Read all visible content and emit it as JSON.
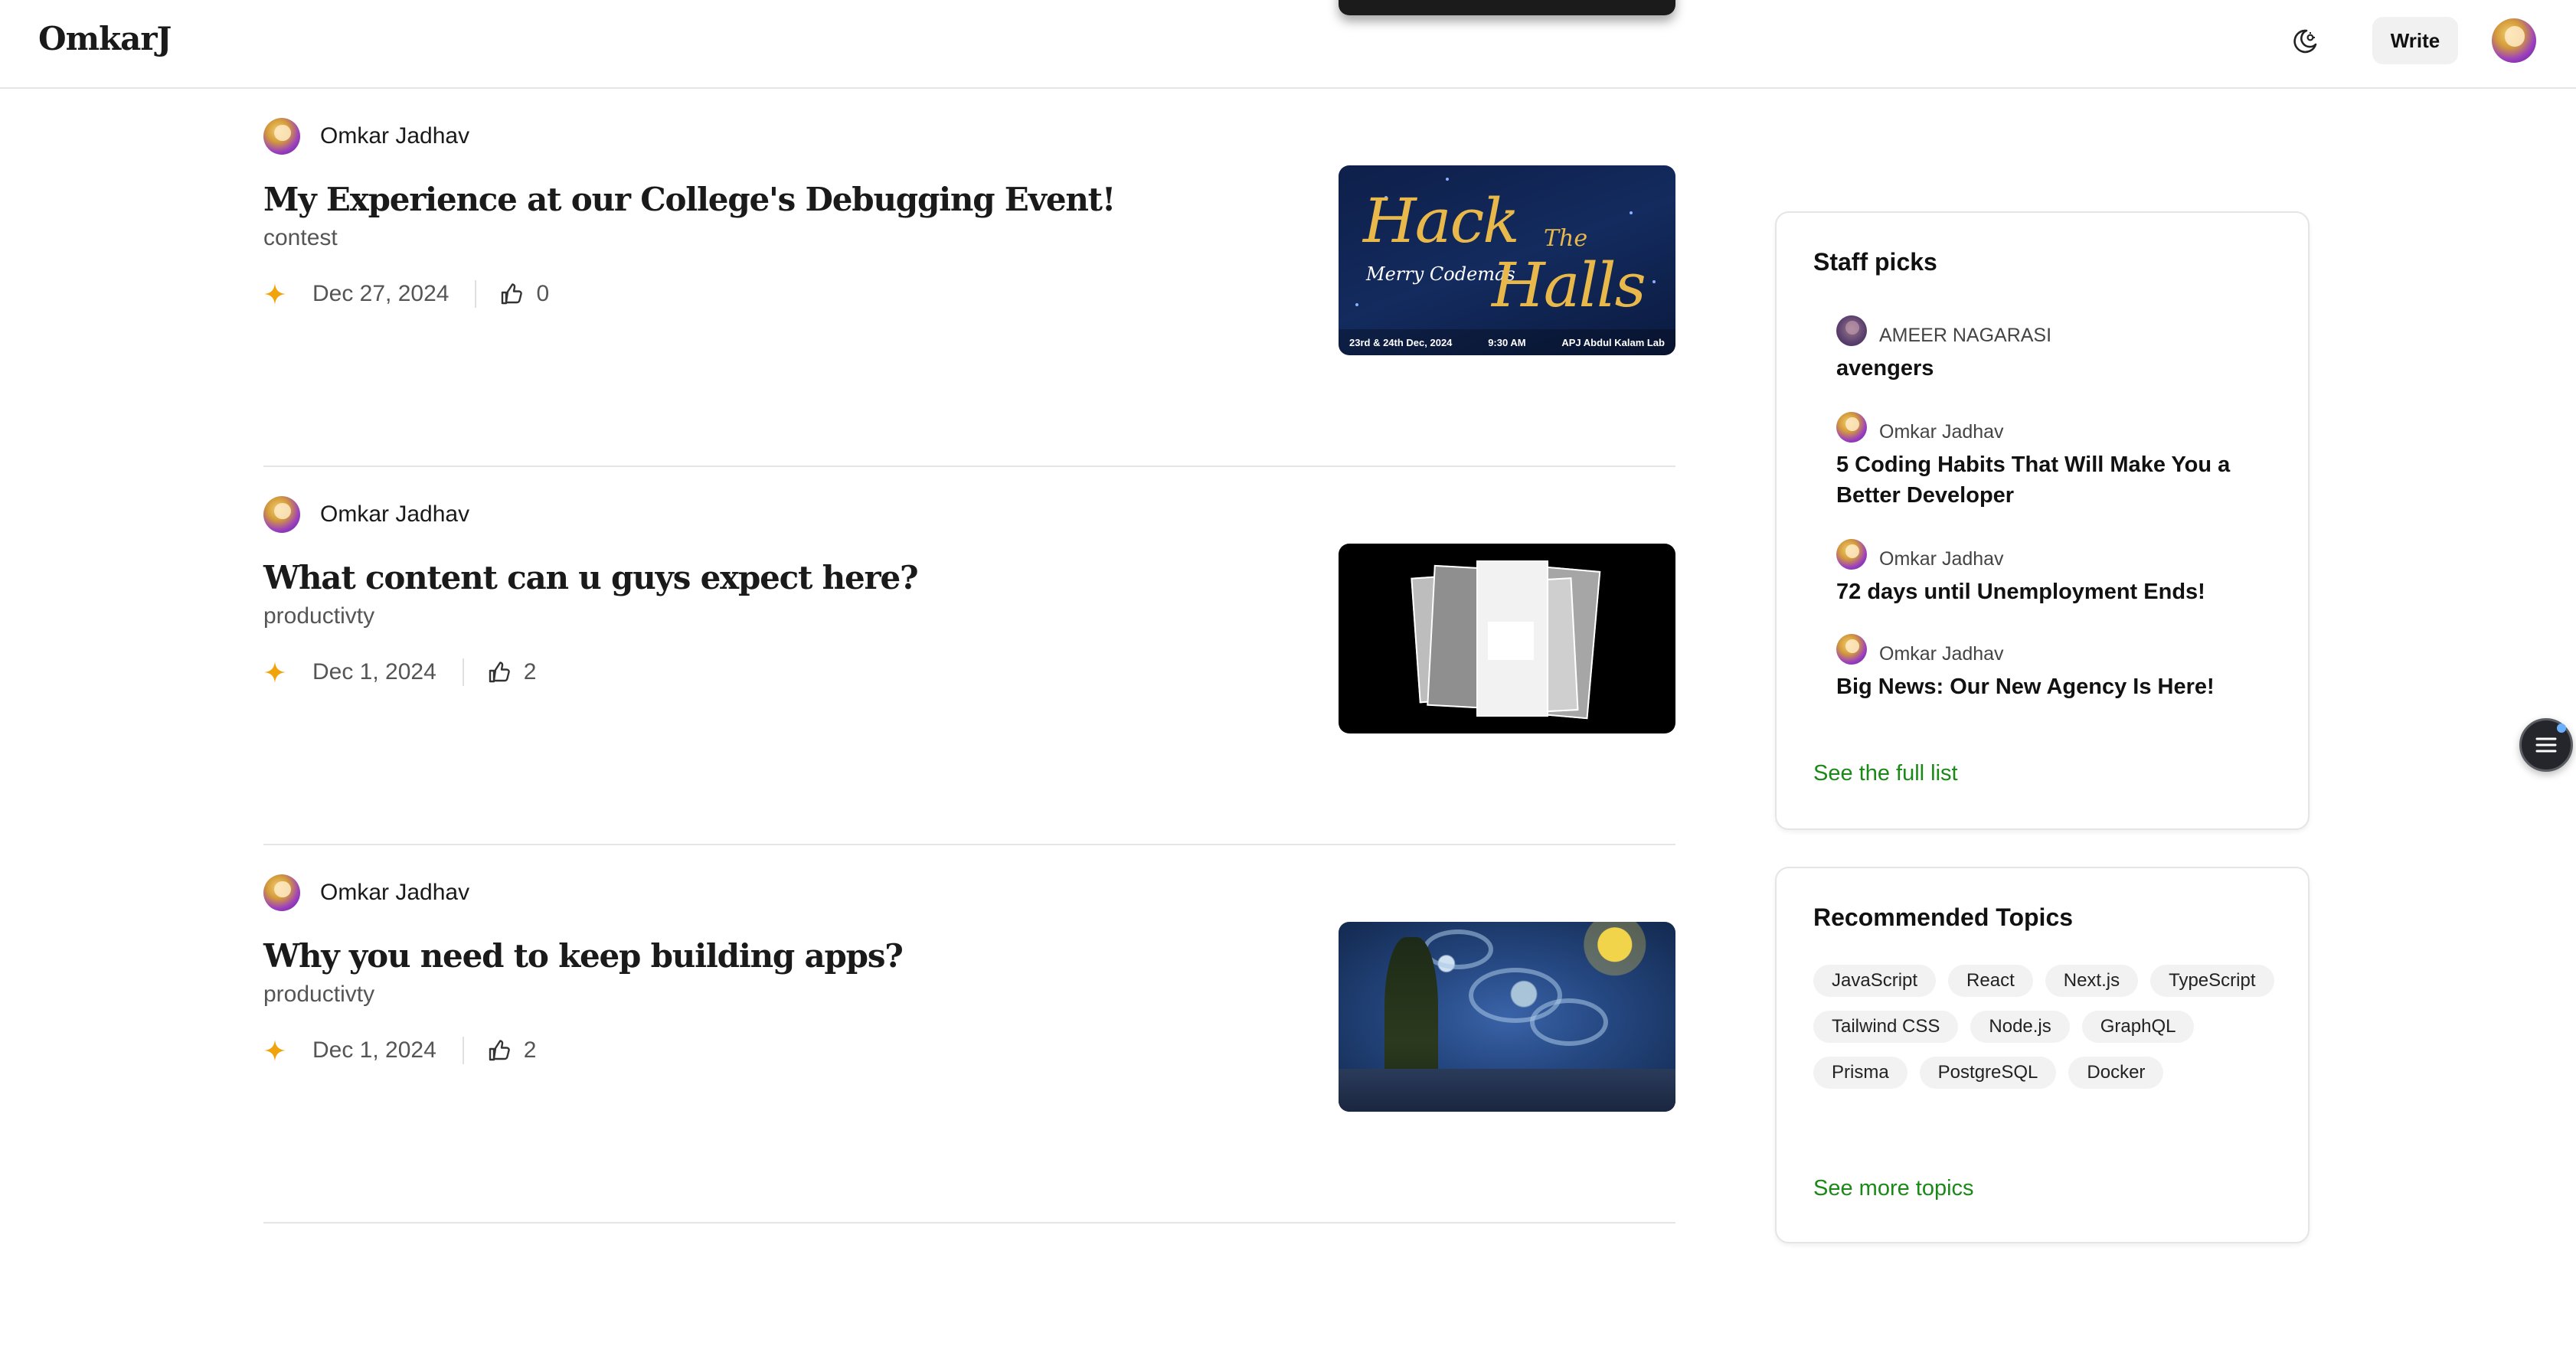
{
  "header": {
    "logo": "OmkarJ",
    "write_label": "Write"
  },
  "icons": {
    "theme_toggle": "moon-sun-icon",
    "like": "thumbs-up-icon",
    "member_star": "sparkle-star-icon",
    "fab": "menu-list-icon"
  },
  "colors": {
    "accent_green": "#1a8917",
    "star": "#f0a30a",
    "divider": "#e5e5e5"
  },
  "posts": [
    {
      "author": "Omkar Jadhav",
      "title": "My Experience at our College's Debugging Event!",
      "tag": "contest",
      "date": "Dec 27, 2024",
      "likes": "0",
      "image": {
        "hack": "Hack",
        "the": "The",
        "halls": "Halls",
        "merry": "Merry Codemas",
        "date_line": "23rd & 24th Dec, 2024",
        "time_line": "9:30 AM",
        "venue_line": "APJ Abdul Kalam Lab"
      }
    },
    {
      "author": "Omkar Jadhav",
      "title": "What content can u guys expect here?",
      "tag": "productivty",
      "date": "Dec 1, 2024",
      "likes": "2"
    },
    {
      "author": "Omkar Jadhav",
      "title": "Why you need to keep building apps?",
      "tag": "productivty",
      "date": "Dec 1, 2024",
      "likes": "2"
    }
  ],
  "staff_picks": {
    "title": "Staff picks",
    "items": [
      {
        "author": "AMEER NAGARASI",
        "title": "avengers"
      },
      {
        "author": "Omkar Jadhav",
        "title": "5 Coding Habits That Will Make You a Better Developer"
      },
      {
        "author": "Omkar Jadhav",
        "title": "72 days until Unemployment Ends!"
      },
      {
        "author": "Omkar Jadhav",
        "title": "Big News: Our New Agency Is Here!"
      }
    ],
    "see_full_list": "See the full list"
  },
  "recommended_topics": {
    "title": "Recommended Topics",
    "topics": [
      "JavaScript",
      "React",
      "Next.js",
      "TypeScript",
      "Tailwind CSS",
      "Node.js",
      "GraphQL",
      "Prisma",
      "PostgreSQL",
      "Docker"
    ],
    "see_more": "See more topics"
  }
}
